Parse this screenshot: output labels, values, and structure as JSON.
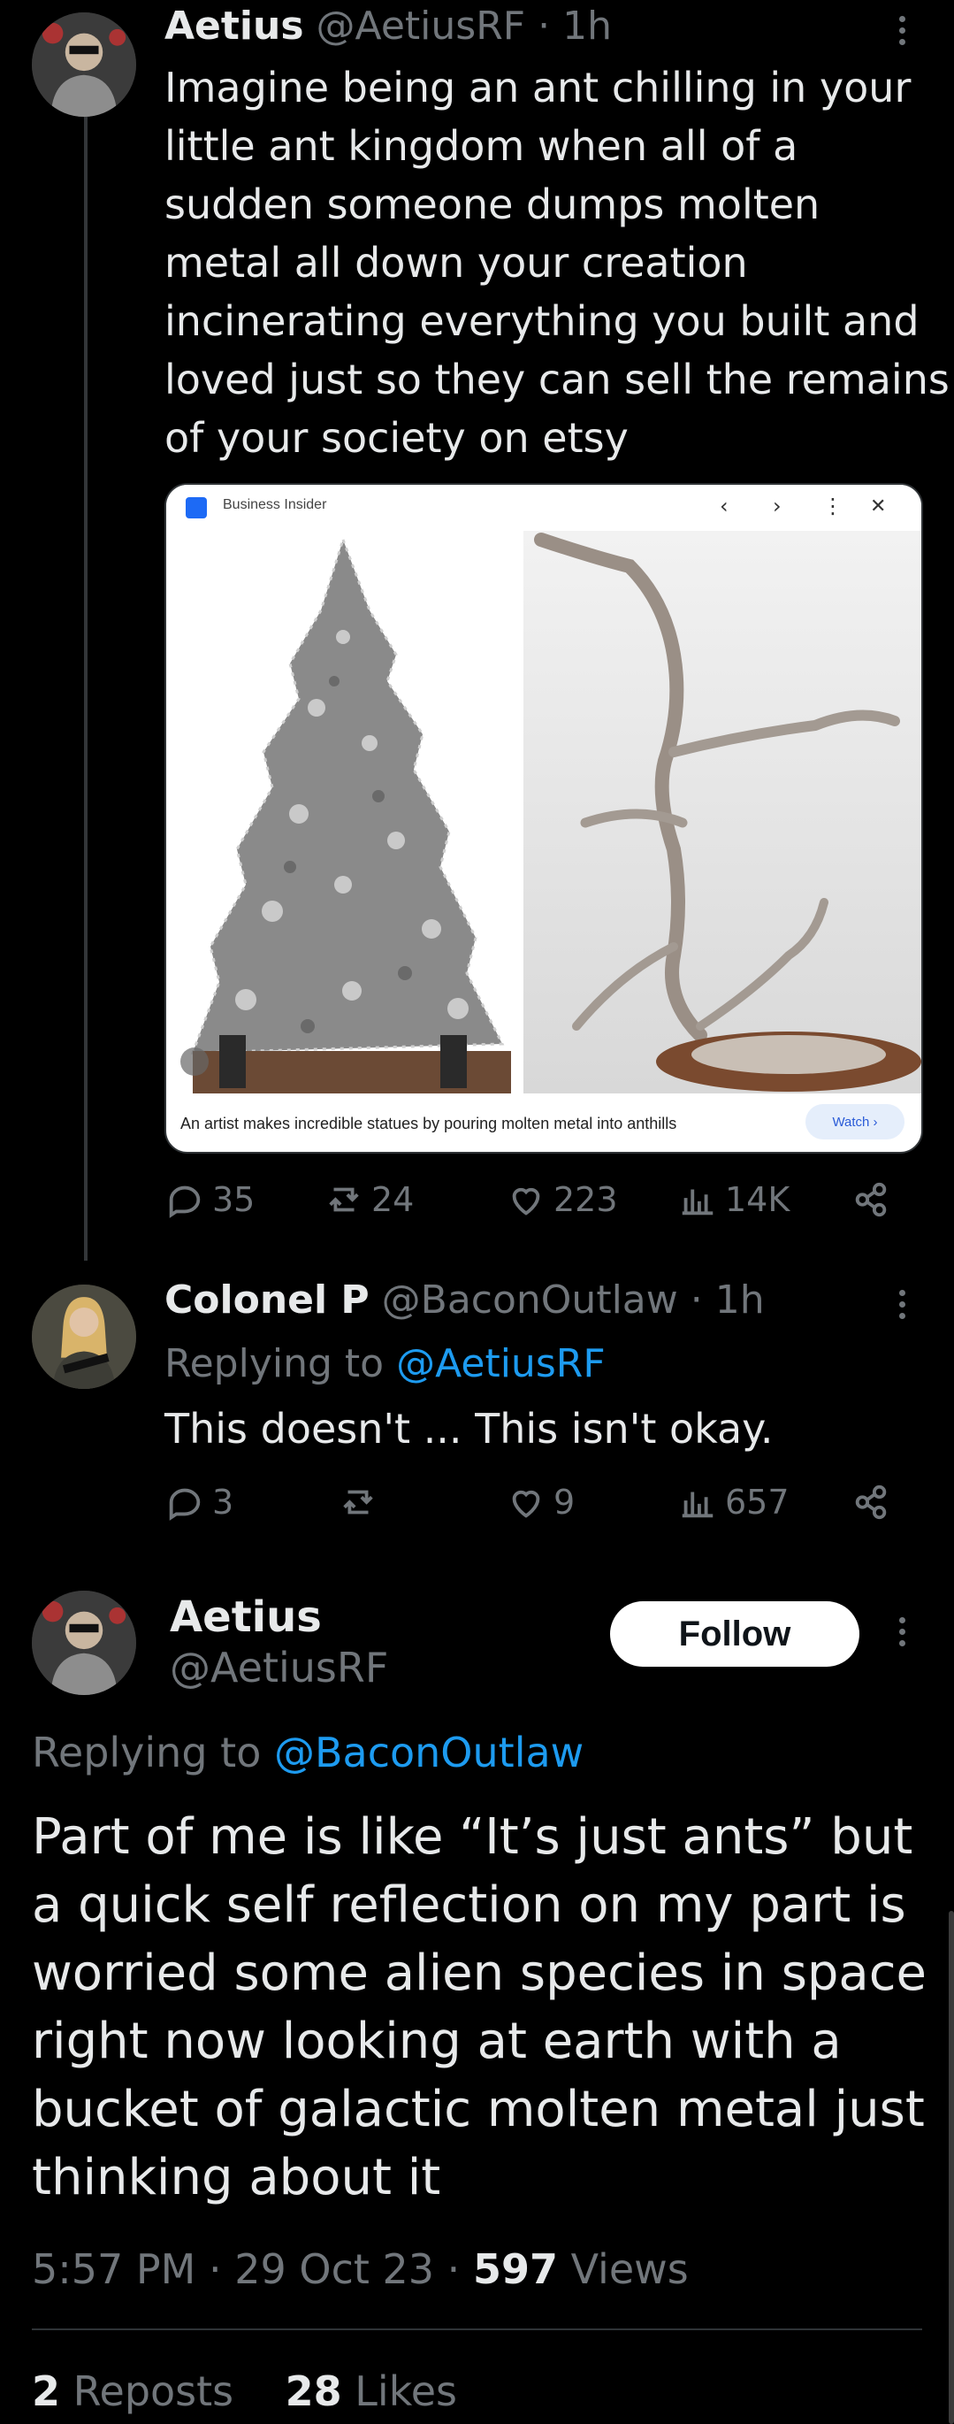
{
  "tweet1": {
    "author_name": "Aetius",
    "handle": "@AetiusRF",
    "time": "· 1h",
    "text": "Imagine being an ant chilling in your\nlittle ant kingdom when all of a\nsudden someone dumps molten\nmetal all down your creation\nincinerating everything you built and\nloved just so they can sell the remains\nof your society on etsy",
    "media": {
      "source": "Business Insider",
      "caption": "An artist makes incredible statues by pouring molten metal into anthills",
      "watch_label": "Watch ›",
      "nav_prev": "‹",
      "nav_next": "›",
      "nav_more": "⋮",
      "nav_close": "✕"
    },
    "replies": "35",
    "reposts": "24",
    "likes": "223",
    "views": "14K"
  },
  "tweet2": {
    "author_name": "Colonel P",
    "handle": "@BaconOutlaw",
    "time": "· 1h",
    "replying_prefix": "Replying to",
    "replying_to": "@AetiusRF",
    "text": "This doesn't ... This isn't okay.",
    "replies": "3",
    "reposts": "",
    "likes": "9",
    "views": "657"
  },
  "main_tweet": {
    "author_name": "Aetius",
    "handle": "@AetiusRF",
    "follow_label": "Follow",
    "replying_prefix": "Replying to",
    "replying_to": "@BaconOutlaw",
    "text": "Part of me is like “It’s just ants” but\na quick self reflection on my part is\nworried some alien species in space\nright now looking at earth with a\nbucket of galactic molten metal just\nthinking about it",
    "time": "5:57 PM · 29 Oct 23 ·",
    "views_count": "597",
    "views_label": "Views",
    "reposts_count": "2",
    "reposts_label": "Reposts",
    "likes_count": "28",
    "likes_label": "Likes"
  },
  "icons": [
    "reply-icon",
    "repost-icon",
    "like-icon",
    "views-icon",
    "share-icon",
    "more-icon"
  ]
}
